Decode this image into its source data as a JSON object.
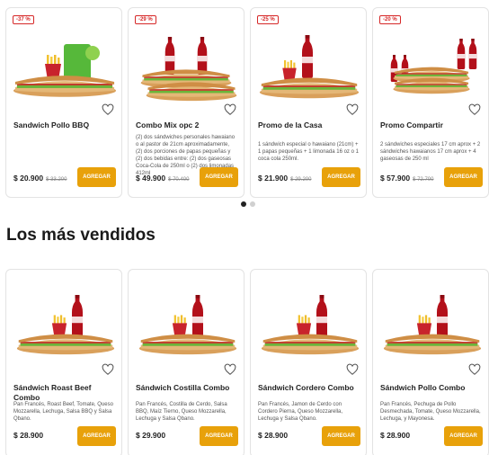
{
  "promos": [
    {
      "badge": "-37 %",
      "name": "Sandwich Pollo BBQ",
      "description": "",
      "price": "$ 20.900",
      "old_price": "$ 33.200",
      "button": "AGREGAR"
    },
    {
      "badge": "-29 %",
      "name": "Combo Mix opc 2",
      "description": "(2) dos sándwiches personales hawaiano o al pastor de 21cm aproximadamente, (2) dos porciones de papas pequeñas y (2) dos bebidas entre: (2) dos gaseosas Coca-Cola de 250ml o (2) dos limonadas 412ml",
      "price": "$ 49.900",
      "old_price": "$ 70.400",
      "button": "AGREGAR"
    },
    {
      "badge": "-25 %",
      "name": "Promo de la Casa",
      "description": "1 sándwich especial o hawaiano (21cm) + 1 papas pequeñas + 1 limonada 16 oz o 1 coca cola 250ml.",
      "price": "$ 21.900",
      "old_price": "$ 29.200",
      "button": "AGREGAR"
    },
    {
      "badge": "-20 %",
      "name": "Promo Compartir",
      "description": "2 sándwiches especiales 17 cm aprox + 2 sándwiches hawaianos 17 cm aprox + 4 gaseosas de 250 ml",
      "price": "$ 57.900",
      "old_price": "$ 72.700",
      "button": "AGREGAR"
    }
  ],
  "carousel": {
    "pages": 2,
    "active": 0
  },
  "section_title": "Los más vendidos",
  "best_sellers": [
    {
      "name": "Sándwich Roast Beef Combo",
      "description": "Pan Francés, Roast Beef, Tomate, Queso Mozzarella, Lechuga, Salsa BBQ y Salsa Qbano.",
      "price": "$ 28.900",
      "button": "AGREGAR"
    },
    {
      "name": "Sándwich Costilla Combo",
      "description": "Pan Francés, Costilla de Cerdo, Salsa BBQ, Maíz Tierno, Queso Mozzarella, Lechuga y Salsa Qbano.",
      "price": "$ 29.900",
      "button": "AGREGAR"
    },
    {
      "name": "Sándwich Cordero Combo",
      "description": "Pan Francés, Jamon de Cerdo con Cordero Pierna, Queso Mozzarella, Lechuga y Salsa Qbano.",
      "price": "$ 28.900",
      "button": "AGREGAR"
    },
    {
      "name": "Sándwich Pollo Combo",
      "description": "Pan Francés, Pechuga de Pollo Desmechada, Tomate, Queso Mozzarella, Lechuga, y Mayonesa.",
      "price": "$ 28.900",
      "button": "AGREGAR"
    }
  ],
  "colors": {
    "accent": "#e8a10a",
    "badge": "#d62828",
    "border": "#e3e3e3"
  }
}
